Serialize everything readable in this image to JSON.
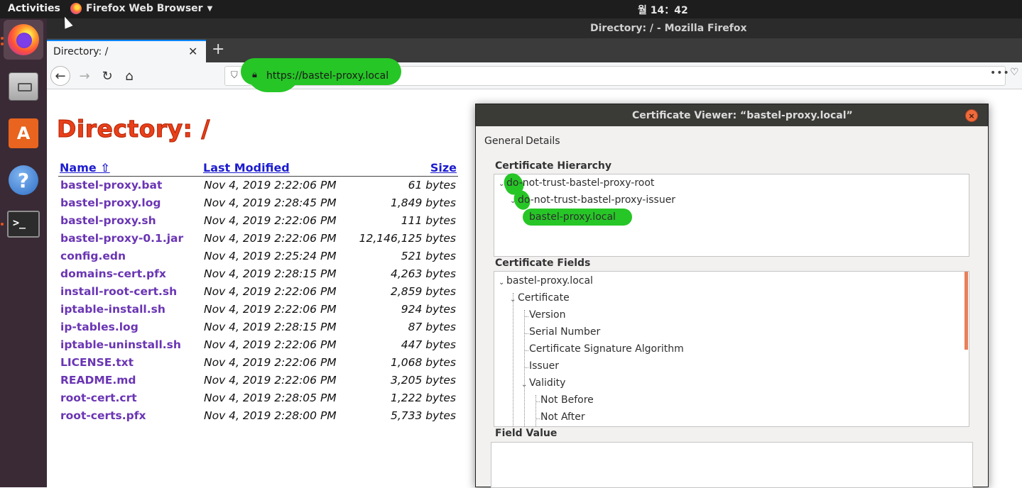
{
  "topbar": {
    "activities": "Activities",
    "app_name": "Firefox Web Browser",
    "clock": "월 14：42"
  },
  "dock": {
    "items": [
      "firefox-icon",
      "files-icon",
      "software-icon",
      "help-icon",
      "terminal-icon"
    ],
    "software_glyph": "A",
    "help_glyph": "?",
    "terminal_glyph": ">_"
  },
  "browser": {
    "window_title": "Directory: / - Mozilla Firefox",
    "tab_title": "Directory: /",
    "new_tab": "+",
    "url": "https://bastel-proxy.local",
    "menu_glyph": "•••"
  },
  "page": {
    "title": "Directory: /",
    "columns": {
      "name": "Name ⇧",
      "modified": "Last Modified",
      "size": "Size"
    },
    "files": [
      {
        "name": "bastel-proxy.bat",
        "modified": "Nov 4, 2019 2:22:06 PM",
        "size": "61 bytes"
      },
      {
        "name": "bastel-proxy.log",
        "modified": "Nov 4, 2019 2:28:45 PM",
        "size": "1,849 bytes"
      },
      {
        "name": "bastel-proxy.sh",
        "modified": "Nov 4, 2019 2:22:06 PM",
        "size": "111 bytes"
      },
      {
        "name": "bastel-proxy-0.1.jar",
        "modified": "Nov 4, 2019 2:22:06 PM",
        "size": "12,146,125 bytes"
      },
      {
        "name": "config.edn",
        "modified": "Nov 4, 2019 2:25:24 PM",
        "size": "521 bytes"
      },
      {
        "name": "domains-cert.pfx",
        "modified": "Nov 4, 2019 2:28:15 PM",
        "size": "4,263 bytes"
      },
      {
        "name": "install-root-cert.sh",
        "modified": "Nov 4, 2019 2:22:06 PM",
        "size": "2,859 bytes"
      },
      {
        "name": "iptable-install.sh",
        "modified": "Nov 4, 2019 2:22:06 PM",
        "size": "924 bytes"
      },
      {
        "name": "ip-tables.log",
        "modified": "Nov 4, 2019 2:28:15 PM",
        "size": "87 bytes"
      },
      {
        "name": "iptable-uninstall.sh",
        "modified": "Nov 4, 2019 2:22:06 PM",
        "size": "447 bytes"
      },
      {
        "name": "LICENSE.txt",
        "modified": "Nov 4, 2019 2:22:06 PM",
        "size": "1,068 bytes"
      },
      {
        "name": "README.md",
        "modified": "Nov 4, 2019 2:22:06 PM",
        "size": "3,205 bytes"
      },
      {
        "name": "root-cert.crt",
        "modified": "Nov 4, 2019 2:28:05 PM",
        "size": "1,222 bytes"
      },
      {
        "name": "root-certs.pfx",
        "modified": "Nov 4, 2019 2:28:00 PM",
        "size": "5,733 bytes"
      }
    ]
  },
  "dialog": {
    "title": "Certificate Viewer: “bastel-proxy.local”",
    "close_glyph": "×",
    "tabs": {
      "general": "General",
      "details": "Details"
    },
    "hierarchy_label": "Certificate Hierarchy",
    "hierarchy": [
      "do-not-trust-bastel-proxy-root",
      "do-not-trust-bastel-proxy-issuer",
      "bastel-proxy.local"
    ],
    "fields_label": "Certificate Fields",
    "fields": [
      "bastel-proxy.local",
      "Certificate",
      "Version",
      "Serial Number",
      "Certificate Signature Algorithm",
      "Issuer",
      "Validity",
      "Not Before",
      "Not After"
    ],
    "value_label": "Field Value",
    "highlight_color": "#26c626"
  }
}
